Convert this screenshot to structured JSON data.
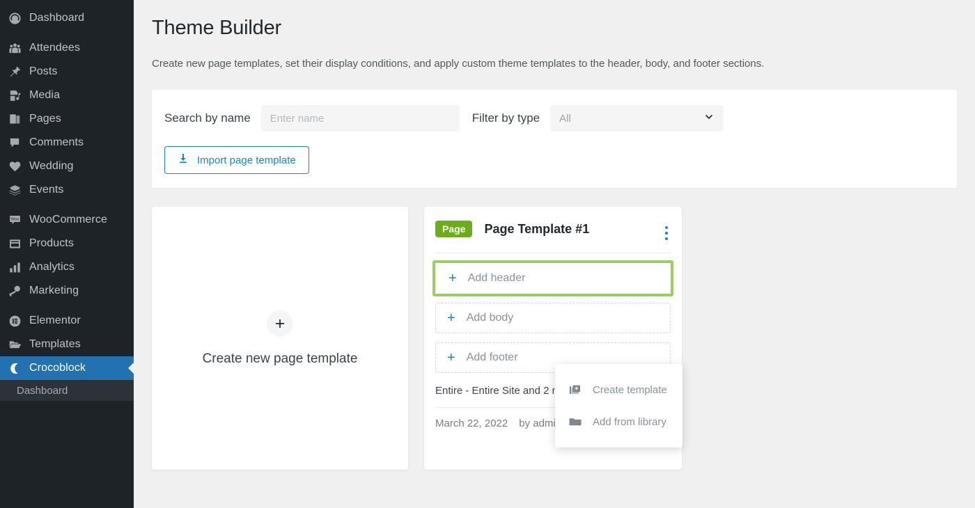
{
  "sidebar": {
    "items": [
      {
        "label": "Dashboard",
        "icon": "dashboard-icon",
        "active": false
      },
      {
        "label": "Attendees",
        "icon": "attendees-icon",
        "active": false
      },
      {
        "label": "Posts",
        "icon": "pin-icon",
        "active": false
      },
      {
        "label": "Media",
        "icon": "media-icon",
        "active": false
      },
      {
        "label": "Pages",
        "icon": "pages-icon",
        "active": false
      },
      {
        "label": "Comments",
        "icon": "comments-icon",
        "active": false
      },
      {
        "label": "Wedding",
        "icon": "heart-icon",
        "active": false
      },
      {
        "label": "Events",
        "icon": "events-icon",
        "active": false
      },
      {
        "label": "WooCommerce",
        "icon": "woocommerce-icon",
        "active": false
      },
      {
        "label": "Products",
        "icon": "products-icon",
        "active": false
      },
      {
        "label": "Analytics",
        "icon": "analytics-icon",
        "active": false
      },
      {
        "label": "Marketing",
        "icon": "marketing-icon",
        "active": false
      },
      {
        "label": "Elementor",
        "icon": "elementor-icon",
        "active": false
      },
      {
        "label": "Templates",
        "icon": "folder-icon",
        "active": false
      },
      {
        "label": "Crocoblock",
        "icon": "crocoblock-icon",
        "active": true
      }
    ],
    "submenu_item": "Dashboard",
    "active_color": "#2271b1"
  },
  "header": {
    "title": "Theme Builder",
    "description": "Create new page templates, set their display conditions, and apply custom theme templates to the header, body, and footer sections."
  },
  "filters": {
    "search_label": "Search by name",
    "search_value": "",
    "search_placeholder": "Enter name",
    "type_label": "Filter by type",
    "type_selected": "All",
    "type_options": [
      "All"
    ],
    "import_button": "Import page template",
    "import_icon": "download-icon",
    "accent_color": "#1787c9"
  },
  "create_card": {
    "plus_icon": "plus-icon",
    "label": "Create new page template"
  },
  "template_card": {
    "badge": "Page",
    "badge_color": "#6cae1a",
    "name": "Page Template #1",
    "menu_icon": "kebab-menu-icon",
    "slots": [
      {
        "label": "Add header",
        "icon": "plus-icon",
        "highlighted": true
      },
      {
        "label": "Add body",
        "icon": "plus-icon",
        "highlighted": false
      },
      {
        "label": "Add footer",
        "icon": "plus-icon",
        "highlighted": false
      }
    ],
    "highlight_color": "#9fcb63",
    "conditions": "Entire - Entire Site and 2 more",
    "date": "March 22, 2022",
    "author": "by admin"
  },
  "dropdown": {
    "items": [
      {
        "label": "Create template",
        "icon": "create-template-icon"
      },
      {
        "label": "Add from library",
        "icon": "folder-icon"
      }
    ]
  }
}
